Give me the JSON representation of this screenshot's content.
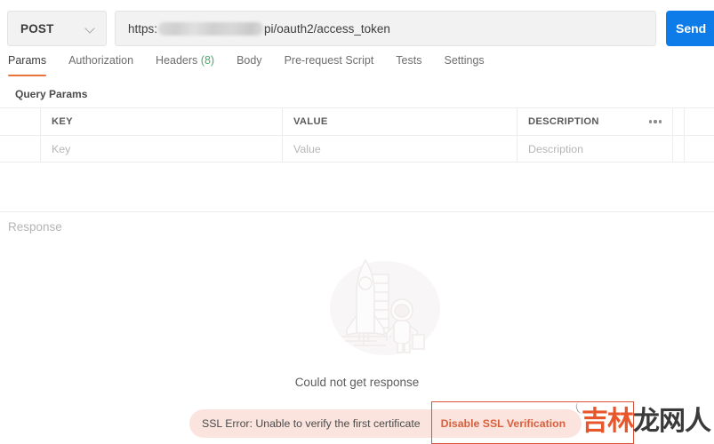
{
  "request": {
    "method": "POST",
    "method_icon": "chevron-down-icon",
    "url_prefix": "https:",
    "url_redacted": true,
    "url_suffix": "pi/oauth2/access_token",
    "send_label": "Send"
  },
  "tabs": [
    {
      "label": "Params",
      "active": true,
      "count": ""
    },
    {
      "label": "Authorization",
      "active": false,
      "count": ""
    },
    {
      "label": "Headers",
      "active": false,
      "count": "(8)"
    },
    {
      "label": "Body",
      "active": false,
      "count": ""
    },
    {
      "label": "Pre-request Script",
      "active": false,
      "count": ""
    },
    {
      "label": "Tests",
      "active": false,
      "count": ""
    },
    {
      "label": "Settings",
      "active": false,
      "count": ""
    }
  ],
  "query_params": {
    "section_title": "Query Params",
    "headers": {
      "key": "KEY",
      "value": "VALUE",
      "description": "DESCRIPTION"
    },
    "more_icon": "ellipsis-horizontal-icon",
    "rows": [
      {
        "key": "Key",
        "value": "Value",
        "description": "Description"
      }
    ]
  },
  "response": {
    "label": "Response",
    "illustration": "rocket-astronaut-illustration",
    "empty_message": "Could not get response",
    "error": {
      "message": "SSL Error: Unable to verify the first certificate",
      "action_label": "Disable SSL Verification"
    }
  },
  "annotation": {
    "highlight_target": "Disable SSL Verification",
    "color": "#d9533a"
  },
  "watermark": {
    "text_accent": "吉林",
    "text_plain": "龙网人",
    "accent_color": "#e8562c"
  },
  "colors": {
    "send_blue": "#0d7ce8",
    "tab_active_underline": "#e8733b",
    "headers_count_green": "#4aa96c",
    "error_bg": "#fae4dd",
    "error_action": "#d9603e",
    "annotation_red": "#d9533a"
  }
}
